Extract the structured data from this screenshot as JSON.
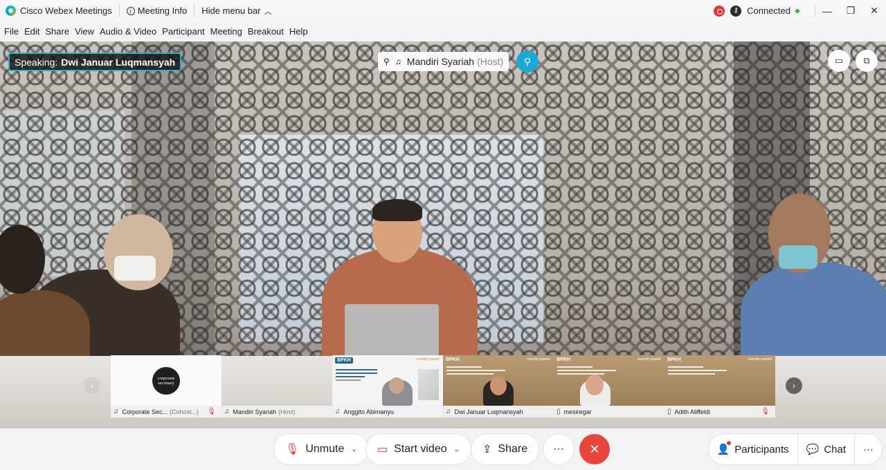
{
  "titlebar": {
    "app_title": "Cisco Webex Meetings",
    "meeting_info": "Meeting Info",
    "hide_menu_bar": "Hide menu bar",
    "status": "Connected",
    "minimize": "—",
    "restore": "❐",
    "close": "✕"
  },
  "menubar": [
    "File",
    "Edit",
    "Share",
    "View",
    "Audio & Video",
    "Participant",
    "Meeting",
    "Breakout",
    "Help"
  ],
  "stage": {
    "speaking_prefix": "Speaking:",
    "speaking_name": "Dwi Januar Luqmansyah",
    "host_name": "Mandiri Syariah",
    "host_role": "(Host)"
  },
  "filmstrip": [
    {
      "name": "Corporate Sec...",
      "role": "(Cohost...)",
      "muted": true,
      "logo_line1": "corporate",
      "logo_line2": "secretary"
    },
    {
      "name": "Mandiri Syariah",
      "role": "(Host)",
      "muted": false
    },
    {
      "name": "Anggito Abimanyu",
      "role": "",
      "muted": false,
      "slide_logo": "BPKH",
      "slide_brand": "mandiri syariah"
    },
    {
      "name": "Dwi Januar Luqmansyah",
      "role": "",
      "muted": false,
      "slide_logo": "BPKH",
      "slide_brand": "mandiri syariah"
    },
    {
      "name": "mesiregar",
      "role": "",
      "muted": false,
      "slide_logo": "BPKH",
      "slide_brand": "mandiri syariah"
    },
    {
      "name": "Adith Aliffeldi",
      "role": "",
      "muted": true,
      "slide_logo": "BPKH",
      "slide_brand": "mandiri syariah"
    }
  ],
  "controls": {
    "unmute": "Unmute",
    "start_video": "Start video",
    "share": "Share",
    "more": "···",
    "participants": "Participants",
    "chat": "Chat"
  },
  "colors": {
    "accent": "#1fb5d8",
    "end_call": "#e8453c",
    "muted_red": "#e0353b",
    "connected_green": "#3cb44b"
  }
}
